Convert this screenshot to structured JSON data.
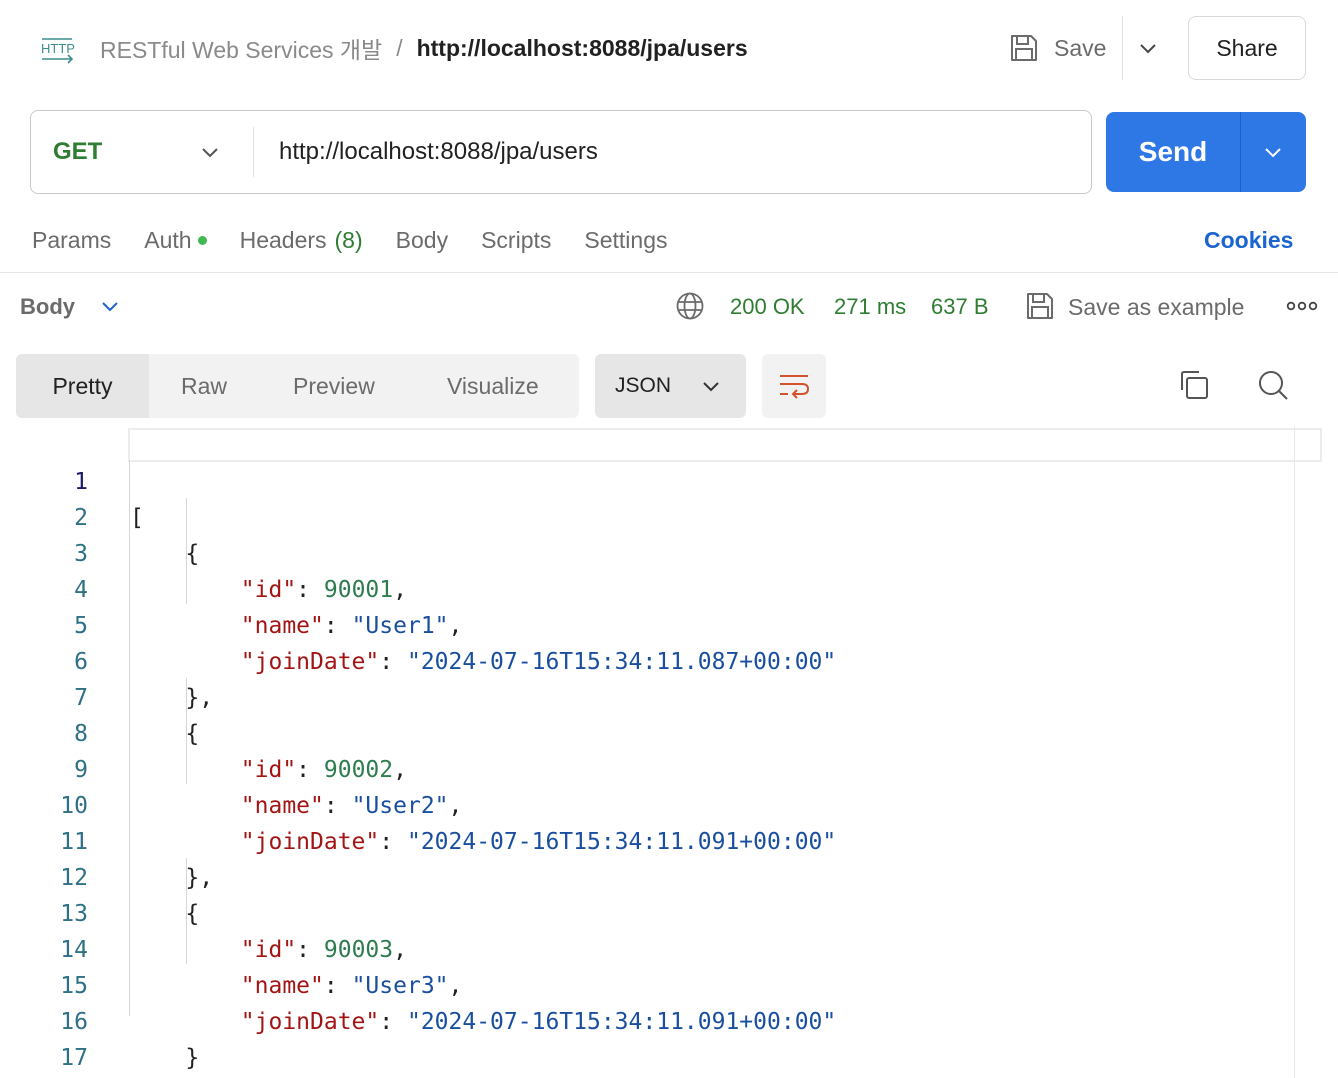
{
  "header": {
    "collection": "RESTful Web Services 개발",
    "separator": "/",
    "request_name": "http://localhost:8088/jpa/users",
    "save_label": "Save",
    "share_label": "Share",
    "http_icon": "HTTP"
  },
  "request": {
    "method": "GET",
    "url": "http://localhost:8088/jpa/users",
    "send_label": "Send"
  },
  "request_tabs": {
    "params": "Params",
    "auth": "Auth",
    "headers": "Headers",
    "headers_count": "(8)",
    "body": "Body",
    "scripts": "Scripts",
    "settings": "Settings",
    "cookies": "Cookies"
  },
  "response": {
    "section_label": "Body",
    "status": "200 OK",
    "time": "271 ms",
    "size": "637 B",
    "save_example_label": "Save as example"
  },
  "view": {
    "tabs": [
      "Pretty",
      "Raw",
      "Preview",
      "Visualize"
    ],
    "active_tab": "Pretty",
    "format": "JSON"
  },
  "colors": {
    "accent": "#2e78e6",
    "status_green": "#2f7d32",
    "json_key": "#a31515",
    "json_number": "#2f7d4f",
    "json_string": "#1a4fa0"
  },
  "code": {
    "line_numbers": [
      "1",
      "2",
      "3",
      "4",
      "5",
      "6",
      "7",
      "8",
      "9",
      "10",
      "11",
      "12",
      "13",
      "14",
      "15",
      "16",
      "17"
    ],
    "users": [
      {
        "id": "90001",
        "name": "\"User1\"",
        "joinDate": "\"2024-07-16T15:34:11.087+00:00\""
      },
      {
        "id": "90002",
        "name": "\"User2\"",
        "joinDate": "\"2024-07-16T15:34:11.091+00:00\""
      },
      {
        "id": "90003",
        "name": "\"User3\"",
        "joinDate": "\"2024-07-16T15:34:11.091+00:00\""
      }
    ],
    "keys": {
      "id": "\"id\"",
      "name": "\"name\"",
      "joinDate": "\"joinDate\""
    },
    "open_bracket": "[",
    "close_bracket": "]",
    "open_brace": "{",
    "close_brace_comma": "},",
    "close_brace": "}"
  }
}
